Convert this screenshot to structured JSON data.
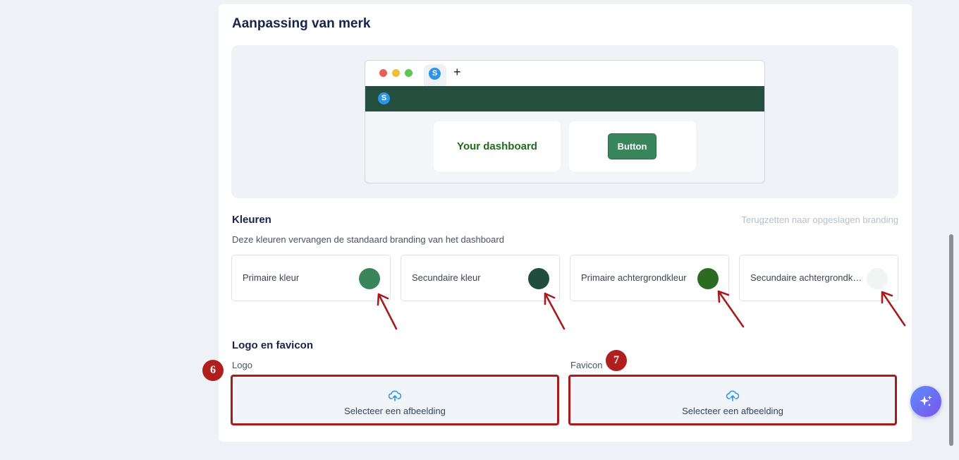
{
  "branding": {
    "title": "Aanpassing van merk",
    "preview": {
      "tab_icon_letter": "S",
      "new_tab_symbol": "+",
      "nav_icon_letter": "S",
      "dashboard_text": "Your dashboard",
      "button_label": "Button"
    }
  },
  "colors": {
    "title": "Kleuren",
    "reset_link": "Terugzetten naar opgeslagen branding",
    "description": "Deze kleuren vervangen de standaard branding van het dashboard",
    "items": [
      {
        "label": "Primaire kleur",
        "color": "#3b855c"
      },
      {
        "label": "Secundaire kleur",
        "color": "#1f4d3e"
      },
      {
        "label": "Primaire achtergrondkleur",
        "color": "#2d6b22"
      },
      {
        "label": "Secundaire achtergrondk…",
        "color": "#eef5f2"
      }
    ]
  },
  "logo_favicon": {
    "title": "Logo en favicon",
    "logo_label": "Logo",
    "favicon_label": "Favicon",
    "logo_upload_text": "Selecteer een afbeelding",
    "favicon_upload_text": "Selecteer een afbeelding"
  },
  "annotations": {
    "badge_logo": "6",
    "badge_favicon": "7",
    "highlight_color": "#a61c1c"
  }
}
